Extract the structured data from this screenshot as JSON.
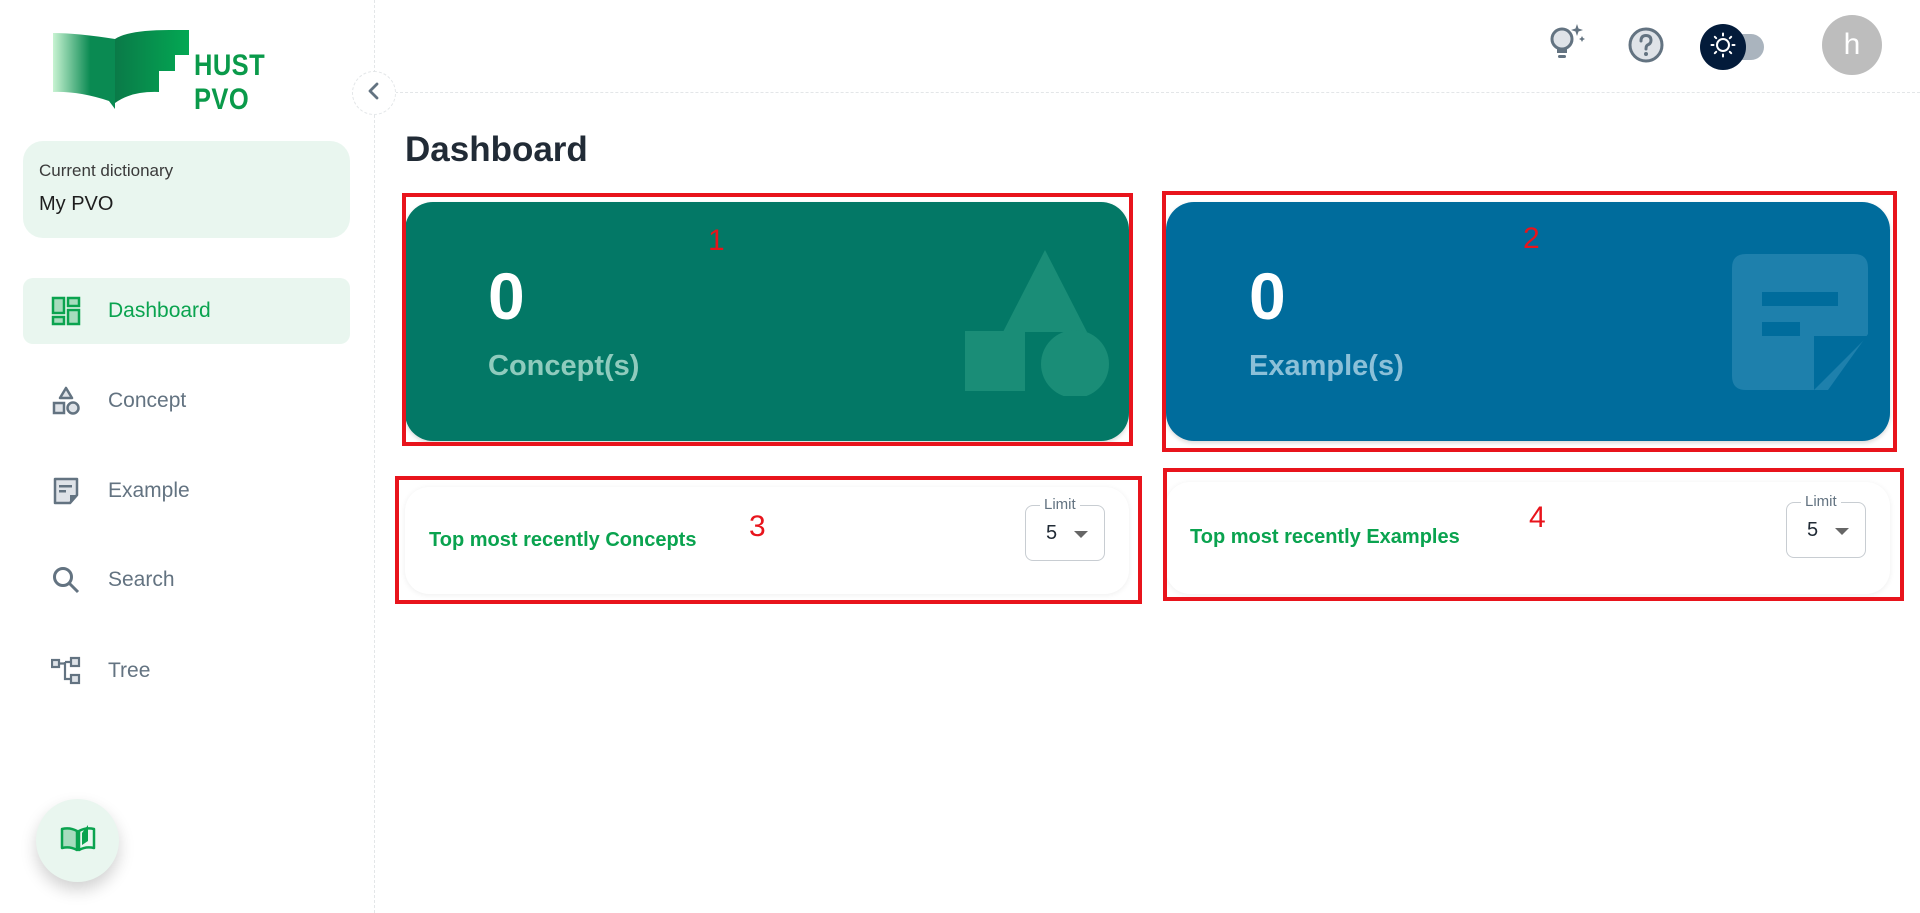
{
  "brand": {
    "name": "HUST PVO",
    "logo_icon": "open-book-logo-icon"
  },
  "sidebar": {
    "current_dictionary_label": "Current dictionary",
    "current_dictionary_value": "My PVO",
    "items": [
      {
        "label": "Dashboard",
        "icon": "dashboard-icon",
        "active": true
      },
      {
        "label": "Concept",
        "icon": "shapes-icon",
        "active": false
      },
      {
        "label": "Example",
        "icon": "note-icon",
        "active": false
      },
      {
        "label": "Search",
        "icon": "search-icon",
        "active": false
      },
      {
        "label": "Tree",
        "icon": "tree-icon",
        "active": false
      }
    ],
    "collapse_icon": "chevron-left-icon",
    "fab_icon": "open-book-icon"
  },
  "header": {
    "icons": [
      "lightbulb-sparkle-icon",
      "help-circle-icon",
      "theme-toggle-sun-icon"
    ],
    "avatar_initial": "h"
  },
  "page": {
    "title": "Dashboard",
    "stats": [
      {
        "value": "0",
        "label": "Concept(s)",
        "color": "#037866",
        "icon": "shapes-icon"
      },
      {
        "value": "0",
        "label": "Example(s)",
        "color": "#006c9c",
        "icon": "note-icon"
      }
    ],
    "lists": [
      {
        "title": "Top most recently Concepts",
        "limit_label": "Limit",
        "limit_value": "5"
      },
      {
        "title": "Top most recently Examples",
        "limit_label": "Limit",
        "limit_value": "5"
      }
    ]
  },
  "annotations": [
    "1",
    "2",
    "3",
    "4"
  ],
  "colors": {
    "accent": "#0aa34f",
    "annotation": "#e8141c",
    "active_bg": "#e9f6ef"
  }
}
